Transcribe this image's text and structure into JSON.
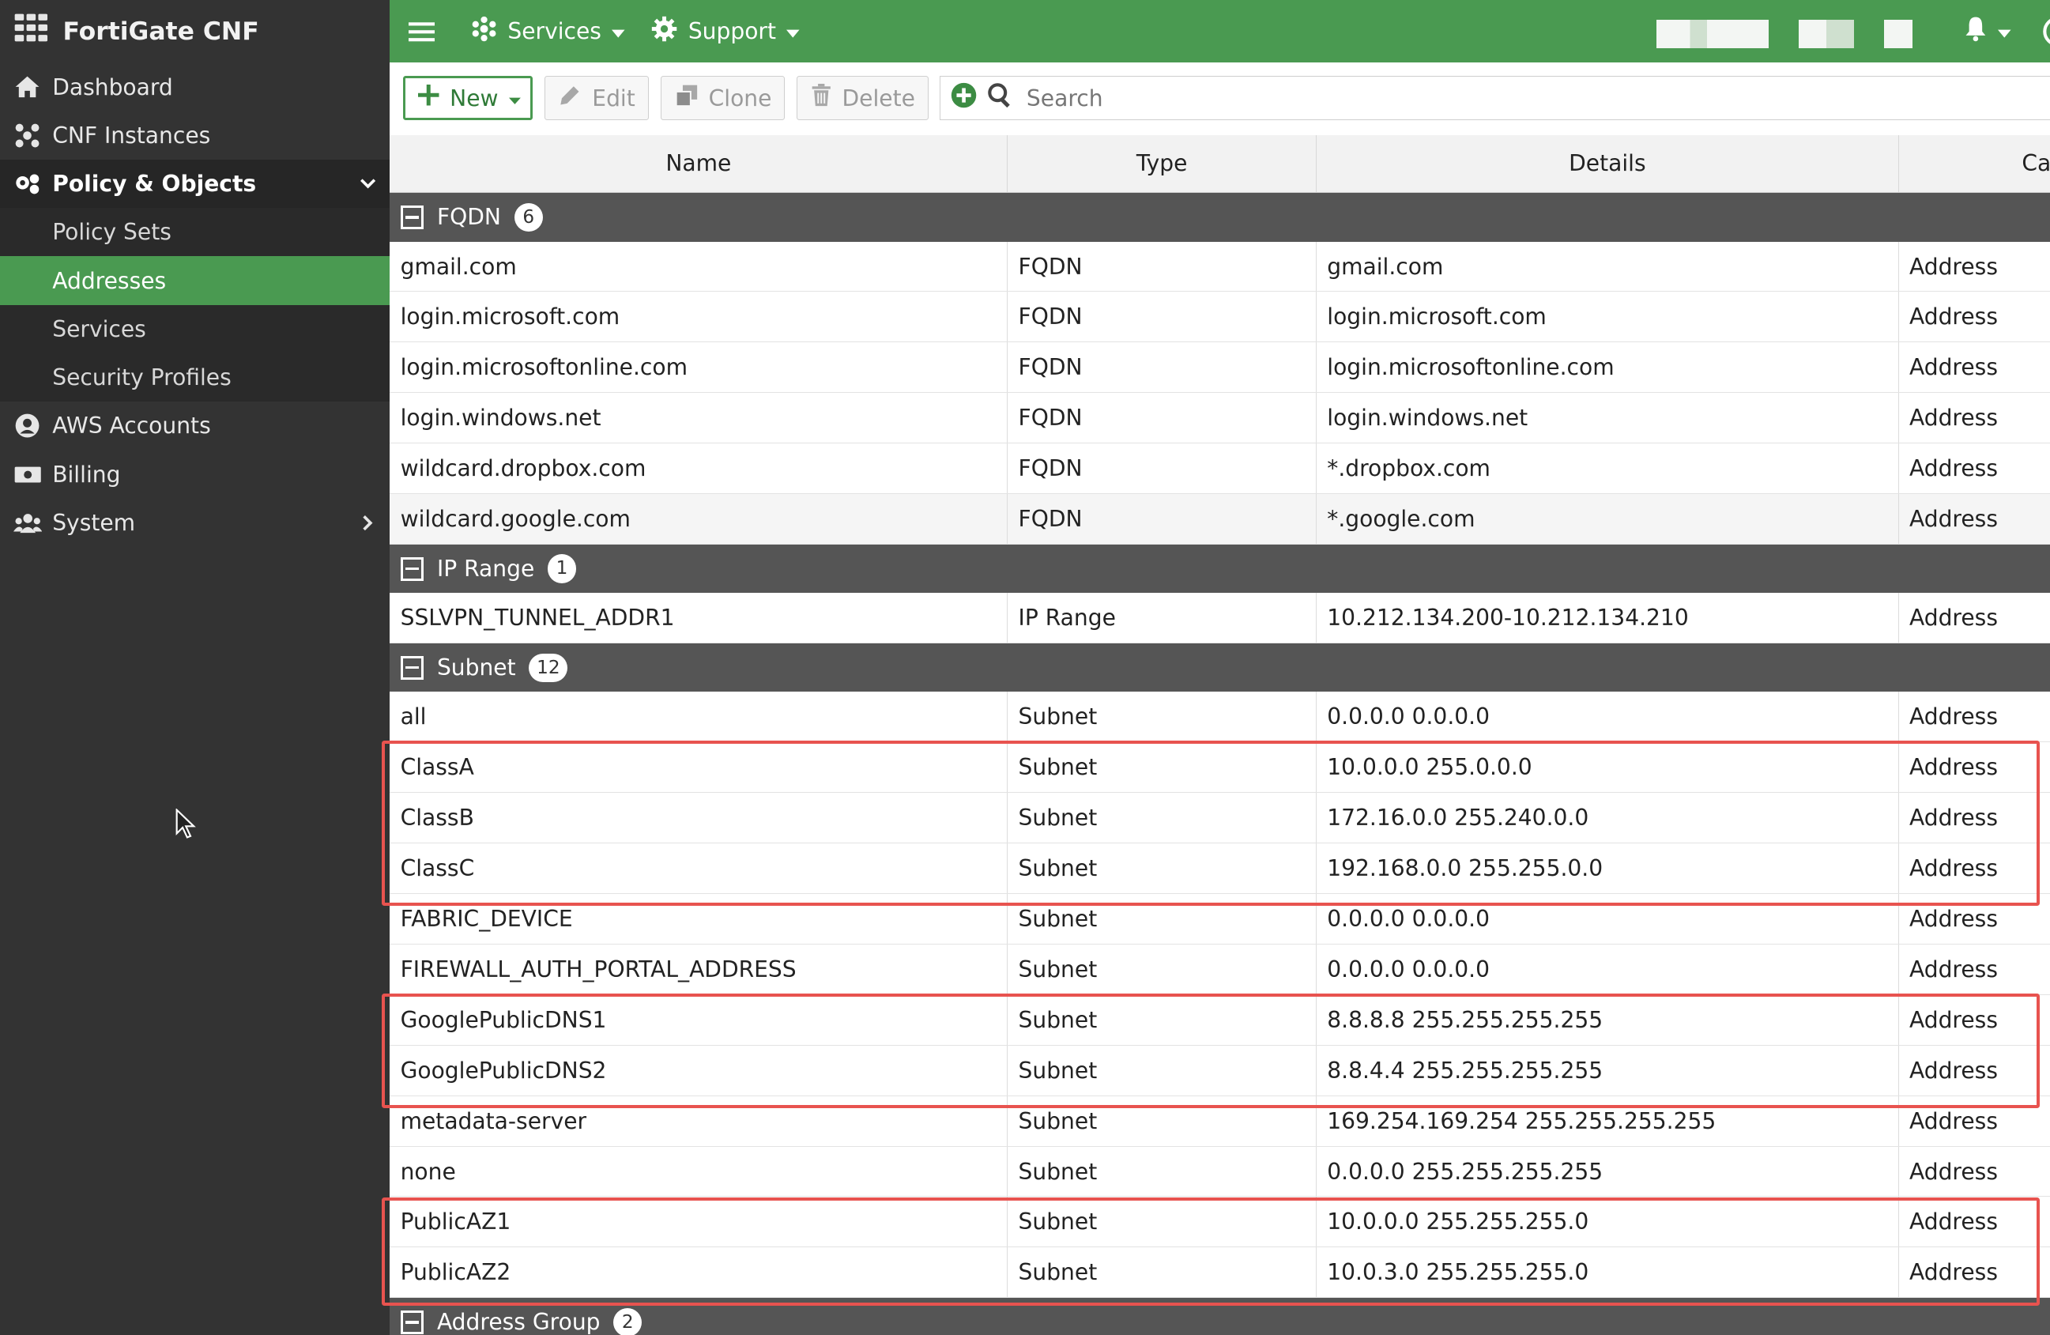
{
  "brand": {
    "title": "FortiGate CNF"
  },
  "sidebar": {
    "items": [
      {
        "label": "Dashboard",
        "icon": "home-icon"
      },
      {
        "label": "CNF Instances",
        "icon": "instances-icon"
      },
      {
        "label": "Policy & Objects",
        "icon": "policy-icon",
        "expanded": true
      },
      {
        "label": "AWS Accounts",
        "icon": "user-circle-icon"
      },
      {
        "label": "Billing",
        "icon": "billing-icon"
      },
      {
        "label": "System",
        "icon": "users-icon"
      }
    ],
    "sub_items": [
      {
        "label": "Policy Sets"
      },
      {
        "label": "Addresses",
        "selected": true
      },
      {
        "label": "Services"
      },
      {
        "label": "Security Profiles"
      }
    ]
  },
  "topbar": {
    "services_label": "Services",
    "support_label": "Support"
  },
  "toolbar": {
    "new_label": "New",
    "edit_label": "Edit",
    "clone_label": "Clone",
    "delete_label": "Delete",
    "search_placeholder": "Search"
  },
  "table": {
    "headers": [
      "Name",
      "Type",
      "Details",
      "Ca"
    ],
    "groups": [
      {
        "label": "FQDN",
        "count": "6"
      },
      {
        "label": "IP Range",
        "count": "1"
      },
      {
        "label": "Subnet",
        "count": "12"
      },
      {
        "label": "Address Group",
        "count": "2"
      }
    ],
    "fqdn_rows": [
      [
        "gmail.com",
        "FQDN",
        "gmail.com",
        "Address"
      ],
      [
        "login.microsoft.com",
        "FQDN",
        "login.microsoft.com",
        "Address"
      ],
      [
        "login.microsoftonline.com",
        "FQDN",
        "login.microsoftonline.com",
        "Address"
      ],
      [
        "login.windows.net",
        "FQDN",
        "login.windows.net",
        "Address"
      ],
      [
        "wildcard.dropbox.com",
        "FQDN",
        "*.dropbox.com",
        "Address"
      ],
      [
        "wildcard.google.com",
        "FQDN",
        "*.google.com",
        "Address"
      ]
    ],
    "iprange_rows": [
      [
        "SSLVPN_TUNNEL_ADDR1",
        "IP Range",
        "10.212.134.200-10.212.134.210",
        "Address"
      ]
    ],
    "subnet_rows": [
      [
        "all",
        "Subnet",
        "0.0.0.0 0.0.0.0",
        "Address"
      ],
      [
        "ClassA",
        "Subnet",
        "10.0.0.0 255.0.0.0",
        "Address"
      ],
      [
        "ClassB",
        "Subnet",
        "172.16.0.0 255.240.0.0",
        "Address"
      ],
      [
        "ClassC",
        "Subnet",
        "192.168.0.0 255.255.0.0",
        "Address"
      ],
      [
        "FABRIC_DEVICE",
        "Subnet",
        "0.0.0.0 0.0.0.0",
        "Address"
      ],
      [
        "FIREWALL_AUTH_PORTAL_ADDRESS",
        "Subnet",
        "0.0.0.0 0.0.0.0",
        "Address"
      ],
      [
        "GooglePublicDNS1",
        "Subnet",
        "8.8.8.8 255.255.255.255",
        "Address"
      ],
      [
        "GooglePublicDNS2",
        "Subnet",
        "8.8.4.4 255.255.255.255",
        "Address"
      ],
      [
        "metadata-server",
        "Subnet",
        "169.254.169.254 255.255.255.255",
        "Address"
      ],
      [
        "none",
        "Subnet",
        "0.0.0.0 255.255.255.255",
        "Address"
      ],
      [
        "PublicAZ1",
        "Subnet",
        "10.0.0.0 255.255.255.0",
        "Address"
      ],
      [
        "PublicAZ2",
        "Subnet",
        "10.0.3.0 255.255.255.0",
        "Address"
      ]
    ]
  },
  "colors": {
    "accent": "#4a9a51",
    "sidebar_bg": "#333333",
    "group_bg": "#555555",
    "highlight": "#e8534f"
  }
}
